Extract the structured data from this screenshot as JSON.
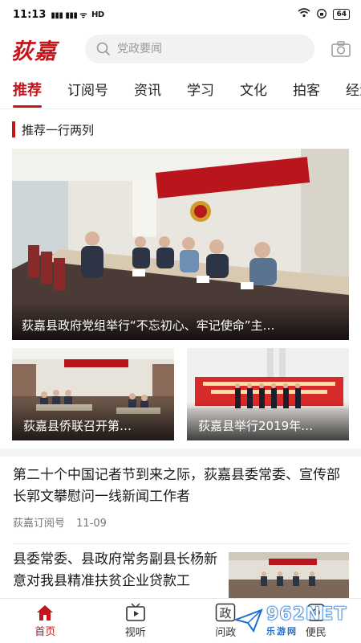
{
  "status_bar": {
    "time": "11:13",
    "signal": "%%%",
    "network": "HD",
    "battery": "64"
  },
  "header": {
    "logo": "荻嘉",
    "search_placeholder": "党政要闻"
  },
  "tabs": [
    {
      "label": "推荐",
      "active": true
    },
    {
      "label": "订阅号"
    },
    {
      "label": "资讯"
    },
    {
      "label": "学习"
    },
    {
      "label": "文化"
    },
    {
      "label": "拍客"
    },
    {
      "label": "经济"
    }
  ],
  "section": {
    "title": "推荐一行两列"
  },
  "cards": {
    "main": {
      "caption": "荻嘉县政府党组举行“不忘初心、牢记使命”主…"
    },
    "left": {
      "caption": "荻嘉县侨联召开第…"
    },
    "right": {
      "caption": "荻嘉县举行2019年…"
    }
  },
  "news": [
    {
      "title": "第二十个中国记者节到来之际，荻嘉县委常委、宣传部长郭文攀慰问一线新闻工作者",
      "source": "荻嘉订阅号",
      "date": "11-09"
    },
    {
      "title": "县委常委、县政府常务副县长杨新意对我县精准扶贫企业贷款工"
    }
  ],
  "bottom_nav": [
    {
      "label": "首页",
      "icon": "home-icon",
      "active": true
    },
    {
      "label": "视听",
      "icon": "tv-icon"
    },
    {
      "label": "问政",
      "icon": "zheng-icon",
      "glyph": "政"
    },
    {
      "label": "便民",
      "icon": "service-icon"
    }
  ],
  "watermark": {
    "big": "962NET",
    "small": "乐游网"
  },
  "colors": {
    "accent": "#c3161c"
  }
}
